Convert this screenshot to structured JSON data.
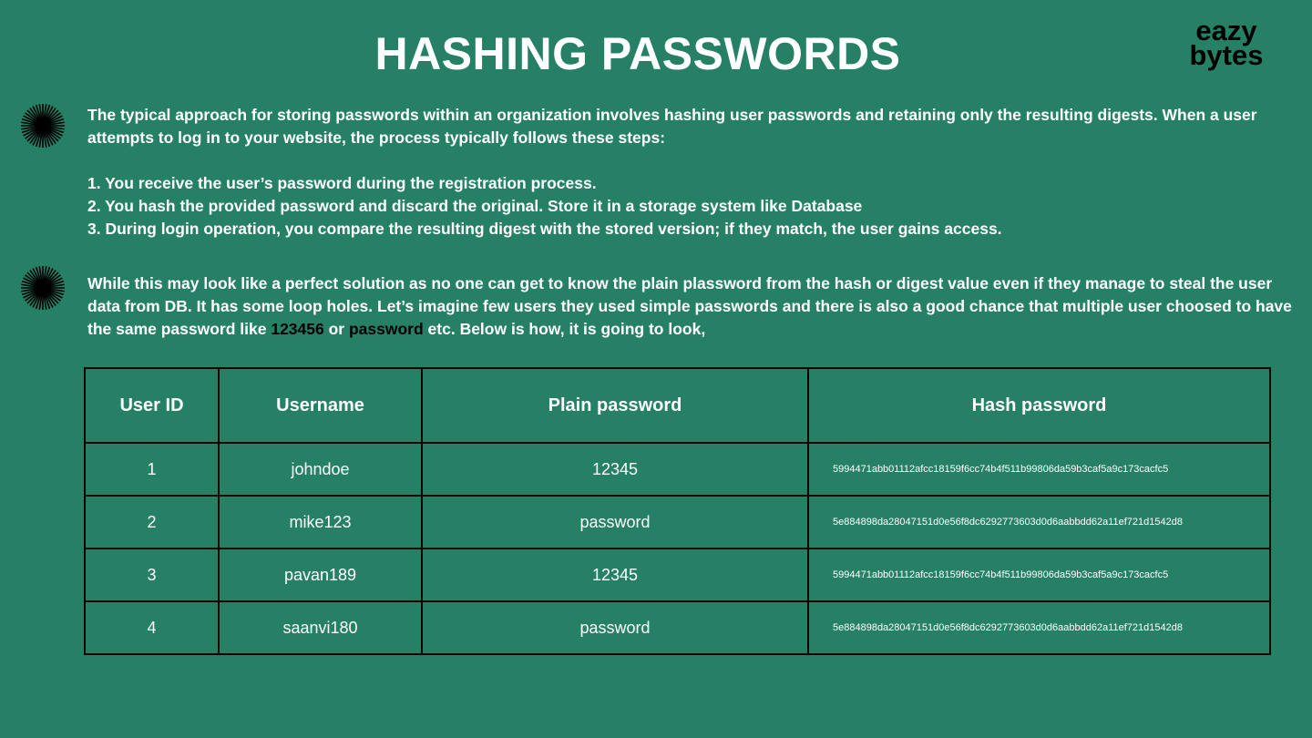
{
  "title": "HASHING PASSWORDS",
  "logo": {
    "line1": "eazy",
    "line2": "bytes"
  },
  "section1": {
    "intro": "The typical approach for storing passwords within an organization involves hashing user passwords and retaining only the resulting digests. When a user attempts to log in to your website, the process typically follows these steps:",
    "steps": [
      "1. You receive the user’s password during the registration process.",
      "2. You hash the provided password and discard the original. Store it in a storage system like Database",
      "3. During login operation, you compare the resulting digest with the stored version; if they match, the user gains access."
    ]
  },
  "section2": {
    "text_before": "While this may look like a perfect solution as no one can get to know the plain plassword from the hash or digest value even if they manage to steal the user data from DB. It has some loop holes. Let’s imagine few users they used simple passwords and there is also a good chance that multiple user choosed to have the same password like ",
    "highlight1": "123456",
    "text_mid": " or ",
    "highlight2": "password",
    "text_after": " etc. Below is how, it is going to look,"
  },
  "table": {
    "headers": [
      "User ID",
      "Username",
      "Plain password",
      "Hash password"
    ],
    "rows": [
      [
        "1",
        "johndoe",
        "12345",
        "5994471abb01112afcc18159f6cc74b4f511b99806da59b3caf5a9c173cacfc5"
      ],
      [
        "2",
        "mike123",
        "password",
        "5e884898da28047151d0e56f8dc6292773603d0d6aabbdd62a11ef721d1542d8"
      ],
      [
        "3",
        "pavan189",
        "12345",
        "5994471abb01112afcc18159f6cc74b4f511b99806da59b3caf5a9c173cacfc5"
      ],
      [
        "4",
        "saanvi180",
        "password",
        "5e884898da28047151d0e56f8dc6292773603d0d6aabbdd62a11ef721d1542d8"
      ]
    ]
  },
  "colors": {
    "background": "#258066",
    "text": "#ffffff",
    "border": "#000000",
    "logo": "#000000"
  },
  "icons": [
    "starburst-icon",
    "starburst-icon"
  ]
}
